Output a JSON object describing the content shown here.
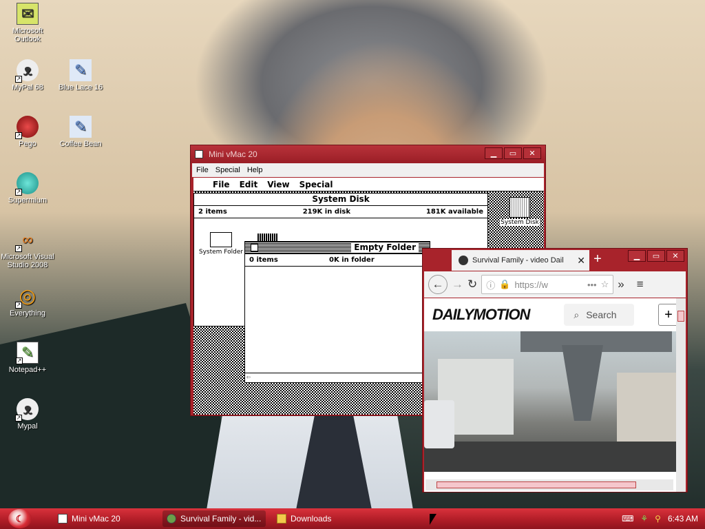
{
  "desktop": {
    "icons": [
      {
        "label": "Microsoft Outlook",
        "icon": "outlook-icon",
        "glyph": "✉",
        "color": "#d7e46a"
      },
      {
        "label": "MyPal 68",
        "icon": "raccoon-icon",
        "glyph": "🦝",
        "color": "#333"
      },
      {
        "label": "Blue Lace 16",
        "icon": "installer-icon",
        "glyph": "✎",
        "color": "#5b8bd9"
      },
      {
        "label": "Pego",
        "icon": "pego-icon",
        "glyph": "●",
        "color": "#c0141e"
      },
      {
        "label": "Coffee Bean",
        "icon": "installer-icon",
        "glyph": "✎",
        "color": "#5b8bd9"
      },
      {
        "label": "Supermium",
        "icon": "supermium-icon",
        "glyph": "◉",
        "color": "#2ac4b4"
      },
      {
        "label": "Microsoft Visual Studio 2008",
        "icon": "visual-studio-icon",
        "glyph": "∞",
        "color": "#e67e22"
      },
      {
        "label": "Everything",
        "icon": "everything-icon",
        "glyph": "◎",
        "color": "#f39c12"
      },
      {
        "label": "Notepad++",
        "icon": "notepadpp-icon",
        "glyph": "✎",
        "color": "#5cab3a"
      },
      {
        "label": "Mypal",
        "icon": "raccoon-icon",
        "glyph": "🦝",
        "color": "#333"
      }
    ]
  },
  "vmac": {
    "title": "Mini vMac 20",
    "menu": [
      "File",
      "Special",
      "Help"
    ],
    "mac_menu": [
      "File",
      "Edit",
      "View",
      "Special"
    ],
    "system_disk": {
      "title": "System Disk",
      "items": "2 items",
      "in_disk": "219K in disk",
      "available": "181K available",
      "folder_label": "System Folder"
    },
    "disk_icon_label": "System Disk",
    "empty_folder": {
      "title": "Empty Folder",
      "items": "0 items",
      "in_folder": "0K in folder"
    }
  },
  "browser": {
    "tab_title": "Survival Family - video Dail",
    "url": "https://w",
    "site_logo": "DAILYMOTION",
    "search_label": "Search"
  },
  "taskbar": {
    "buttons": [
      {
        "label": "Mini vMac 20",
        "icon": "vmac-icon"
      },
      {
        "label": "Survival Family - vid...",
        "icon": "browser-icon"
      },
      {
        "label": "Downloads",
        "icon": "folder-icon"
      }
    ],
    "clock": "6:43 AM"
  },
  "colors": {
    "accent": "#a8232b",
    "taskbar": "#b51f29"
  }
}
